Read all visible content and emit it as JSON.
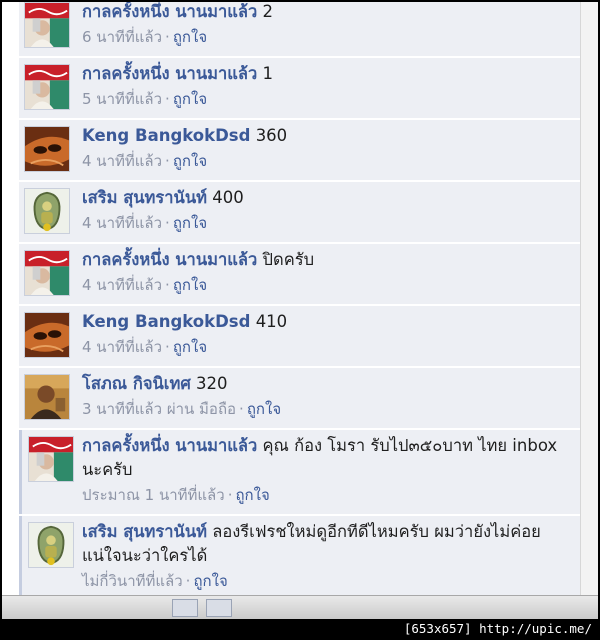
{
  "comments": [
    {
      "author": "กาลครั้งหนึ่ง นานมาแล้ว",
      "text": "2",
      "time": "6 นาทีที่แล้ว",
      "like": "ถูกใจ",
      "avatar": "coca-cola-avatar"
    },
    {
      "author": "กาลครั้งหนึ่ง นานมาแล้ว",
      "text": "1",
      "time": "5 นาทีที่แล้ว",
      "like": "ถูกใจ",
      "avatar": "coca-cola-avatar"
    },
    {
      "author": "Keng BangkokDsd",
      "text": "360",
      "time": "4 นาทีที่แล้ว",
      "like": "ถูกใจ",
      "avatar": "mask-avatar"
    },
    {
      "author": "เสริม สุนทรานันท์",
      "text": "400",
      "time": "4 นาทีที่แล้ว",
      "like": "ถูกใจ",
      "avatar": "amulet-avatar"
    },
    {
      "author": "กาลครั้งหนึ่ง นานมาแล้ว",
      "text": "ปิดครับ",
      "time": "4 นาทีที่แล้ว",
      "like": "ถูกใจ",
      "avatar": "coca-cola-avatar"
    },
    {
      "author": "Keng BangkokDsd",
      "text": "410",
      "time": "4 นาทีที่แล้ว",
      "like": "ถูกใจ",
      "avatar": "mask-avatar"
    },
    {
      "author": "โสภณ กิจนิเทศ",
      "text": "320",
      "time": "3 นาทีที่แล้ว ผ่าน มือถือ",
      "like": "ถูกใจ",
      "avatar": "person-avatar"
    },
    {
      "author": "กาลครั้งหนึ่ง นานมาแล้ว",
      "text": "คุณ ก้อง โมรา รับไป๓๕๐บาท ไทย inbox นะครับ",
      "time": "ประมาณ 1 นาทีที่แล้ว",
      "like": "ถูกใจ",
      "avatar": "coca-cola-avatar"
    },
    {
      "author": "เสริม สุนทรานันท์",
      "text": "ลองรีเฟรชใหม่ดูอีกทีดีไหมครับ ผมว่ายังไม่ค่อยแน่ใจนะว่าใครได้",
      "time": "ไม่กี่วินาทีที่แล้ว",
      "like": "ถูกใจ",
      "avatar": "amulet-avatar"
    }
  ],
  "status_bar": {
    "text": "[653x657] http://upic.me/"
  }
}
